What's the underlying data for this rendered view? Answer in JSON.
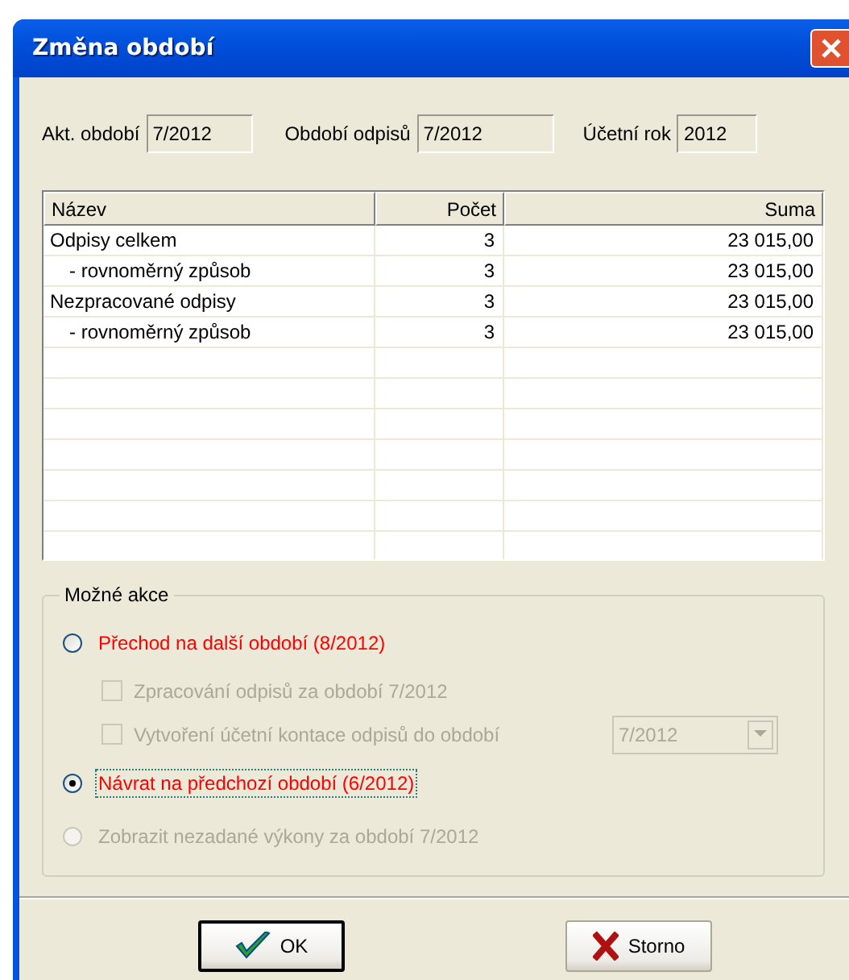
{
  "window": {
    "title": "Změna období"
  },
  "fields": [
    {
      "label": "Akt. období",
      "value": "7/2012"
    },
    {
      "label": "Období odpisů",
      "value": "7/2012"
    },
    {
      "label": "Účetní rok",
      "value": "2012"
    }
  ],
  "table": {
    "columns": [
      "Název",
      "Počet",
      "Suma"
    ],
    "rows": [
      {
        "cells": [
          "Odpisy celkem",
          "3",
          "23 015,00"
        ],
        "children": [
          {
            "cells": [
              "- rovnoměrný způsob",
              "3",
              "23 015,00"
            ]
          }
        ]
      },
      {
        "cells": [
          "Nezpracované odpisy",
          "3",
          "23 015,00"
        ],
        "children": [
          {
            "cells": [
              "- rovnoměrný způsob",
              "3",
              "23 015,00"
            ]
          }
        ]
      }
    ]
  },
  "actions": {
    "title": "Možné akce",
    "options": [
      {
        "kind": "radio",
        "label": "Přechod na další období (8/2012)",
        "selected": false,
        "disabled": false,
        "focused": false,
        "color": "#ff0000",
        "children": [
          {
            "kind": "checkbox",
            "label": "Zpracování odpisů za období 7/2012",
            "checked": false,
            "disabled": true
          },
          {
            "kind": "checkbox",
            "label": "Vytvoření účetní kontace odpisů do období",
            "checked": false,
            "disabled": true,
            "dropdown": "7/2012"
          }
        ]
      },
      {
        "kind": "radio",
        "label": "Návrat na předchozí období (6/2012)",
        "selected": true,
        "disabled": false,
        "focused": true,
        "color": "#ff0000"
      },
      {
        "kind": "radio",
        "label": "Zobrazit nezadané výkony za období 7/2012",
        "selected": false,
        "disabled": true,
        "focused": false
      }
    ]
  },
  "buttons": [
    {
      "kind": "ok",
      "label": "OK"
    },
    {
      "kind": "cancel",
      "label": "Storno"
    }
  ]
}
